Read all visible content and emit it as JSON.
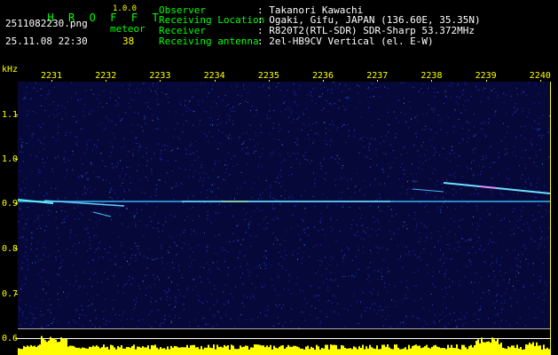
{
  "app": {
    "title": "H R O F F T",
    "version": "1.0.0",
    "filename": "2511082230.png",
    "datetime": "25.11.08 22:30",
    "meteor_label": "meteor",
    "meteor_count": "38"
  },
  "info": [
    {
      "label": "Observer",
      "value": ": Takanori Kawachi"
    },
    {
      "label": "Receiving Location",
      "value": ": Ogaki, Gifu, JAPAN (136.60E, 35.35N)"
    },
    {
      "label": "Receiver",
      "value": ": R820T2(RTL-SDR) SDR-Sharp 53.372MHz"
    },
    {
      "label": "Receiving antenna",
      "value": ": 2el-HB9CV Vertical (el. E-W)"
    }
  ],
  "axis": {
    "unit": "kHz",
    "time_labels": [
      "2231",
      "2232",
      "2233",
      "2234",
      "2235",
      "2236",
      "2237",
      "2238",
      "2239",
      "2240"
    ],
    "freq_labels": [
      "1.1",
      "1.0",
      "0.9",
      "0.8",
      "0.7",
      "0.6"
    ]
  },
  "colors": {
    "background": "#000000",
    "plot_bg": "#07083a",
    "label_green": "#00ff00",
    "label_yellow": "#ffff00",
    "carrier": "#4dd0ff",
    "level": "#ffff00"
  }
}
